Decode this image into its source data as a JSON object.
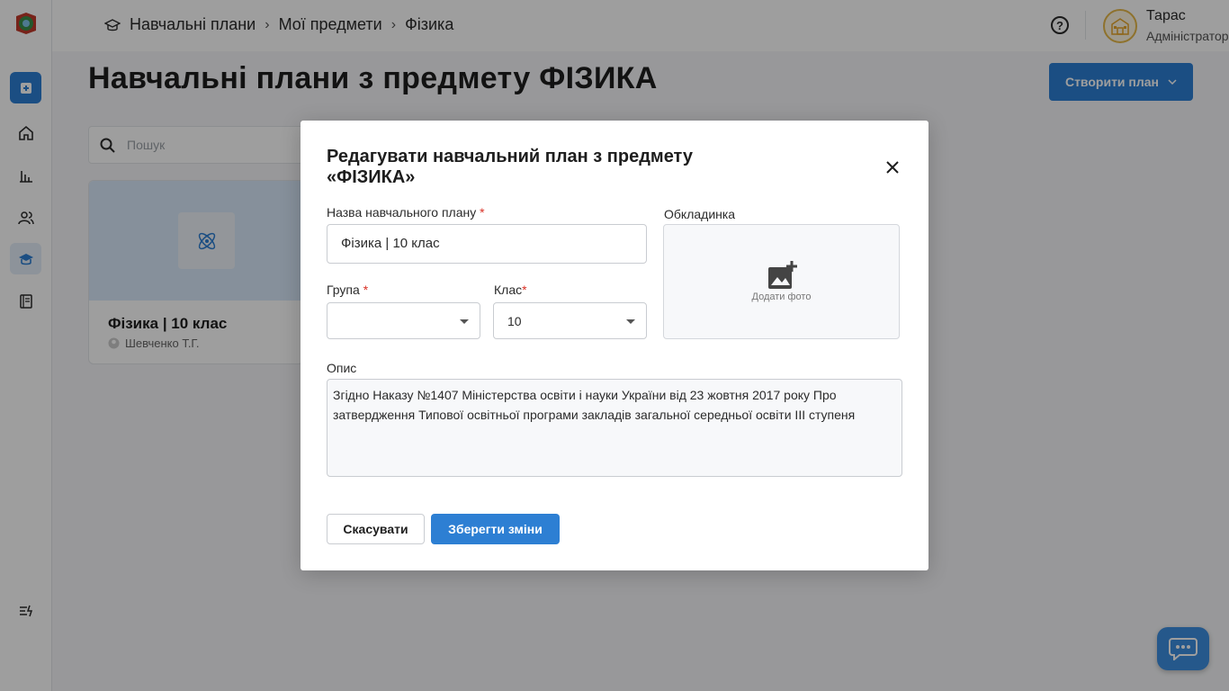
{
  "breadcrumb": {
    "items": [
      "Навчальні плани",
      "Мої предмети",
      "Фізика"
    ],
    "separator": "›"
  },
  "header": {
    "user_name": "Тарас",
    "user_role": "Адміністратор",
    "help_glyph": "?"
  },
  "page": {
    "title": "Навчальні плани з предмету ФІЗИКА",
    "create_button": "Створити план",
    "search_placeholder": "Пошук"
  },
  "card": {
    "title": "Фізика | 10 клас",
    "author": "Шевченко Т.Г."
  },
  "modal": {
    "title": "Редагувати навчальний план з предмету «ФІЗИКА»",
    "name_label": "Назва навчального плану",
    "name_value": "Фізика | 10 клас",
    "group_label": "Група",
    "group_value": "",
    "class_label": "Клас",
    "class_value": "10",
    "cover_label": "Обкладинка",
    "cover_add_text": "Додати фото",
    "description_label": "Опис",
    "description_value": "Згідно Наказу №1407 Міністерства освіти і науки України від 23 жовтня 2017 року Про затвердження Типової освітньої програми закладів загальної середньої освіти ІІІ ступеня",
    "required_mark": "*",
    "cancel_button": "Скасувати",
    "save_button": "Зберегти зміни"
  },
  "colors": {
    "accent": "#2d7fd3",
    "required": "#d93025",
    "overlay": "rgba(0,0,0,0.38)"
  },
  "icons": {
    "sidebar": [
      "add-icon",
      "home-icon",
      "chart-icon",
      "users-icon",
      "education-icon",
      "journal-icon",
      "settings-icon"
    ],
    "chat": "chat-icon"
  }
}
